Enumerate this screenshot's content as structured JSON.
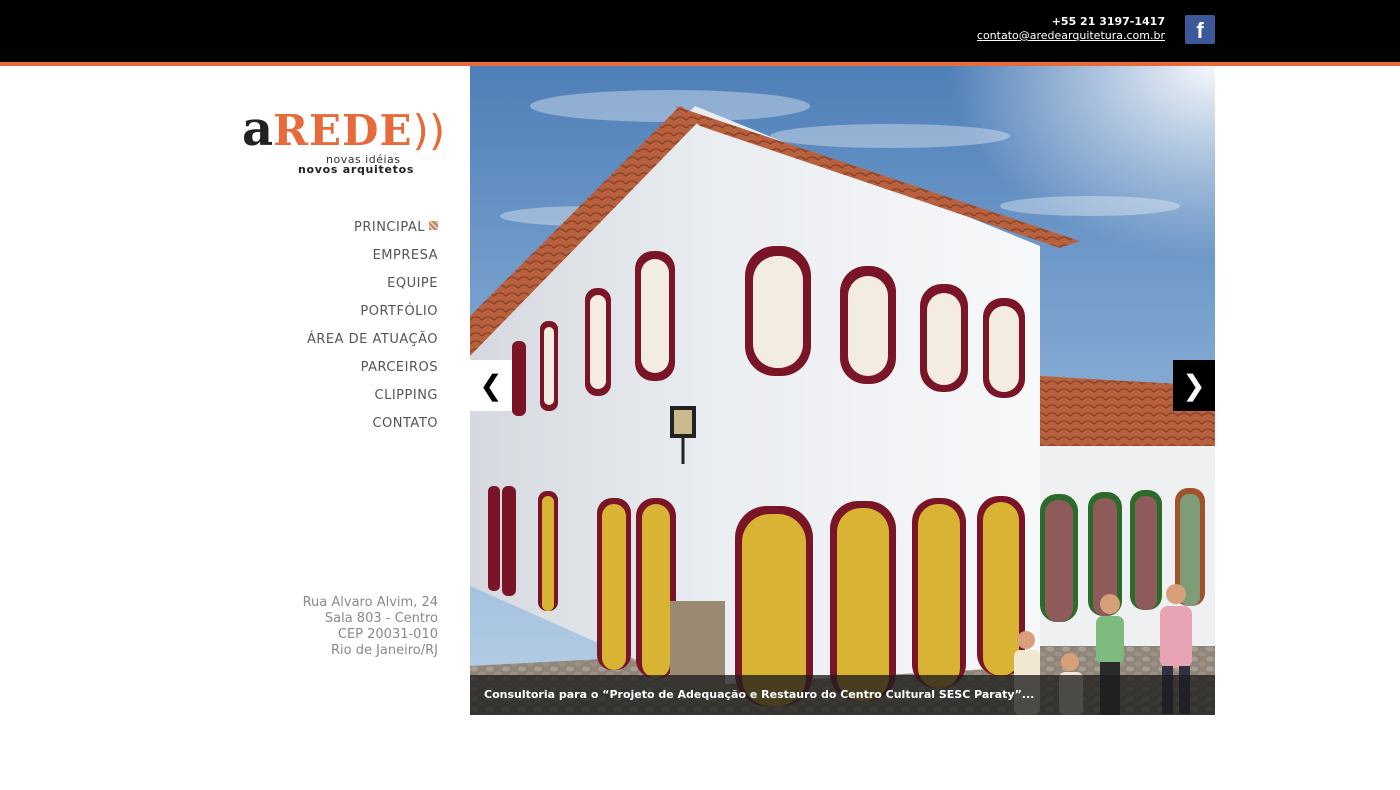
{
  "header": {
    "phone": "+55 21 3197-1417",
    "email": "contato@aredearquitetura.com.br",
    "facebook_glyph": "f"
  },
  "logo": {
    "letter": "a",
    "word": "REDE",
    "parens": "))",
    "tagline1": "novas idéias",
    "tagline2": "novos arquitetos"
  },
  "nav": {
    "items": [
      {
        "label": "PRINCIPAL",
        "active": true
      },
      {
        "label": "EMPRESA"
      },
      {
        "label": "EQUIPE"
      },
      {
        "label": "PORTFÓLIO"
      },
      {
        "label": "ÁREA DE ATUAÇÃO"
      },
      {
        "label": "PARCEIROS"
      },
      {
        "label": "CLIPPING"
      },
      {
        "label": "CONTATO"
      }
    ]
  },
  "address": {
    "line1": "Rua Alvaro Alvim, 24",
    "line2": "Sala 803 - Centro",
    "line3": "CEP 20031-010",
    "line4": "Rio de Janeiro/RJ"
  },
  "slider": {
    "prev_glyph": "❮",
    "next_glyph": "❯",
    "caption": "Consultoria para o “Projeto de Adequação e Restauro do Centro Cultural SESC Paraty”..."
  },
  "colors": {
    "accent": "#e8693a",
    "window_frame": "#7a1528",
    "door_yellow": "#d9b334"
  }
}
